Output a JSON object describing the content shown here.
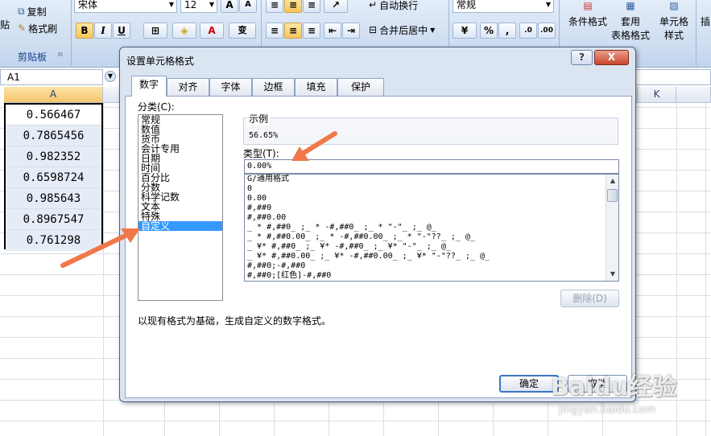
{
  "ribbon": {
    "paste_label": "贴",
    "copy_label": "复制",
    "format_painter_label": "格式刷",
    "clipboard_group_label": "剪贴板",
    "font_name": "宋体",
    "font_size": "12",
    "bold": "B",
    "italic": "I",
    "underline": "U",
    "font_color_letter": "A",
    "phonetic_label": "变",
    "wrap_text_label": "自动换行",
    "merge_center_label": "合并后居中",
    "number_format": "常规",
    "percent_label": "%",
    "comma_label": ",",
    "conditional_format_label": "条件格式",
    "table_format_label_line1": "套用",
    "table_format_label_line2": "表格格式",
    "cell_styles_label_line1": "单元格",
    "cell_styles_label_line2": "样式",
    "insert_partial_label": "插"
  },
  "formula_bar": {
    "name_box": "A1"
  },
  "sheet": {
    "columns": [
      "A",
      "K"
    ],
    "cells_a": [
      "0.566467",
      "0.7865456",
      "0.982352",
      "0.6598724",
      "0.985643",
      "0.8967547",
      "0.761298"
    ]
  },
  "dialog": {
    "title": "设置单元格格式",
    "help": "?",
    "close": "X",
    "tabs": [
      "数字",
      "对齐",
      "字体",
      "边框",
      "填充",
      "保护"
    ],
    "active_tab": "数字",
    "category_label": "分类(C):",
    "categories": [
      "常规",
      "数值",
      "货币",
      "会计专用",
      "日期",
      "时间",
      "百分比",
      "分数",
      "科学记数",
      "文本",
      "特殊",
      "自定义"
    ],
    "selected_category": "自定义",
    "sample_label": "示例",
    "sample_value": "56.65%",
    "type_label": "类型(T):",
    "type_value": "0.00%",
    "format_list": [
      "G/通用格式",
      "0",
      "0.00",
      "#,##0",
      "#,##0.00",
      "_ * #,##0_ ;_ * -#,##0_ ;_ * \"-\"_ ;_ @_",
      "_ * #,##0.00_ ;_ * -#,##0.00_ ;_ * \"-\"??_ ;_ @_",
      "_ ¥* #,##0_ ;_ ¥* -#,##0_ ;_ ¥* \"-\"_ ;_ @_",
      "_ ¥* #,##0.00_ ;_ ¥* -#,##0.00_ ;_ ¥* \"-\"??_ ;_ @_",
      "#,##0;-#,##0",
      "#,##0;[红色]-#,##0"
    ],
    "delete_button": "删除(D)",
    "description": "以现有格式为基础，生成自定义的数字格式。",
    "ok_button": "确定",
    "cancel_button": "取消"
  },
  "watermark": {
    "brand": "Baidu经验",
    "url": "jingyan.baidu.com"
  },
  "colors": {
    "annotation_arrow": "#f0784a",
    "selection": "#3399ff",
    "ribbon_text": "#15428b"
  }
}
